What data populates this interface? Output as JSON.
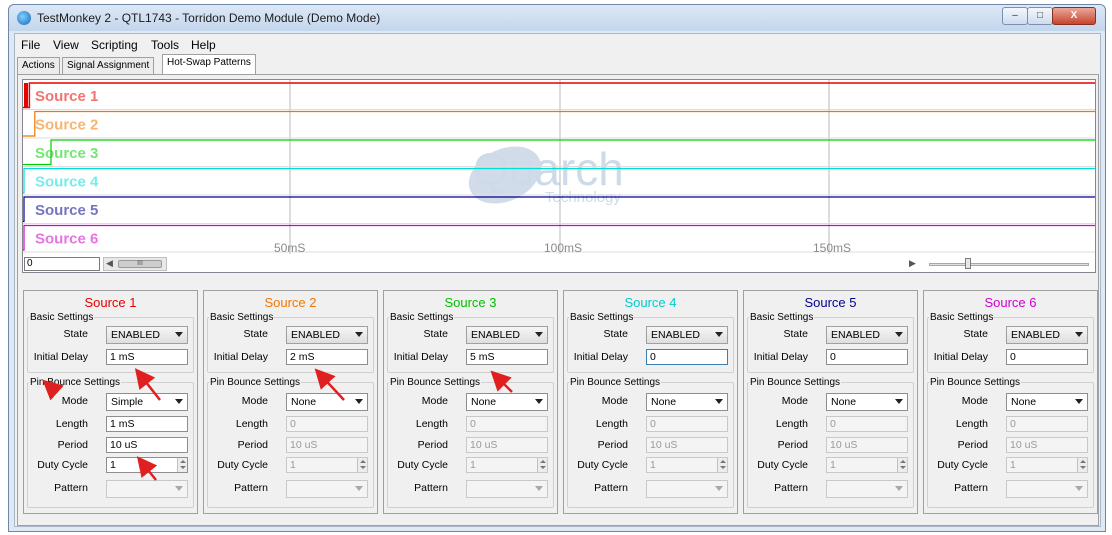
{
  "window": {
    "title": "TestMonkey 2 - QTL1743 - Torridon Demo Module (Demo Mode)",
    "minimize_glyph": "–",
    "maximize_glyph": "□",
    "close_glyph": "X"
  },
  "menu": [
    "File",
    "View",
    "Scripting",
    "Tools",
    "Help"
  ],
  "tabs": [
    {
      "label": "Actions",
      "active": false
    },
    {
      "label": "Signal Assignment",
      "active": false
    },
    {
      "label": "Hot-Swap Patterns",
      "active": true
    }
  ],
  "waveform": {
    "sources": [
      {
        "name": "Source 1",
        "color": "#e60000",
        "delay_ms": 1
      },
      {
        "name": "Source 2",
        "color": "#f07800",
        "delay_ms": 2
      },
      {
        "name": "Source 3",
        "color": "#00d200",
        "delay_ms": 5
      },
      {
        "name": "Source 4",
        "color": "#00dcdc",
        "delay_ms": 0
      },
      {
        "name": "Source 5",
        "color": "#000090",
        "delay_ms": 0
      },
      {
        "name": "Source 6",
        "color": "#d000d0",
        "delay_ms": 0
      }
    ],
    "time_labels": [
      "50mS",
      "100mS",
      "150mS"
    ],
    "watermark": {
      "name": "Quarch",
      "sub": "Technology"
    },
    "position_value": "0",
    "scroll_thumb": "III",
    "scroll_left": "◀",
    "scroll_right": "▶"
  },
  "labels": {
    "basic": "Basic Settings",
    "state": "State",
    "initial_delay": "Initial Delay",
    "pin_bounce": "Pin Bounce Settings",
    "mode": "Mode",
    "length": "Length",
    "period": "Period",
    "duty_cycle": "Duty Cycle",
    "pattern": "Pattern"
  },
  "panels": [
    {
      "title": "Source 1",
      "color": "#e60000",
      "state": "ENABLED",
      "initial_delay": "1 mS",
      "mode": "Simple",
      "mode_enabled": true,
      "length": "1 mS",
      "period": "10 uS",
      "duty_cycle": "1",
      "pattern": ""
    },
    {
      "title": "Source 2",
      "color": "#f07800",
      "state": "ENABLED",
      "initial_delay": "2 mS",
      "mode": "None",
      "mode_enabled": true,
      "length": "0",
      "period": "10 uS",
      "duty_cycle": "1",
      "pattern": ""
    },
    {
      "title": "Source 3",
      "color": "#00c000",
      "state": "ENABLED",
      "initial_delay": "5 mS",
      "mode": "None",
      "mode_enabled": true,
      "length": "0",
      "period": "10 uS",
      "duty_cycle": "1",
      "pattern": ""
    },
    {
      "title": "Source 4",
      "color": "#00cccc",
      "state": "ENABLED",
      "initial_delay": "0",
      "mode": "None",
      "mode_enabled": true,
      "length": "0",
      "period": "10 uS",
      "duty_cycle": "1",
      "pattern": ""
    },
    {
      "title": "Source 5",
      "color": "#000090",
      "state": "ENABLED",
      "initial_delay": "0",
      "mode": "None",
      "mode_enabled": true,
      "length": "0",
      "period": "10 uS",
      "duty_cycle": "1",
      "pattern": ""
    },
    {
      "title": "Source 6",
      "color": "#d000d0",
      "state": "ENABLED",
      "initial_delay": "0",
      "mode": "None",
      "mode_enabled": true,
      "length": "0",
      "period": "10 uS",
      "duty_cycle": "1",
      "pattern": ""
    }
  ]
}
